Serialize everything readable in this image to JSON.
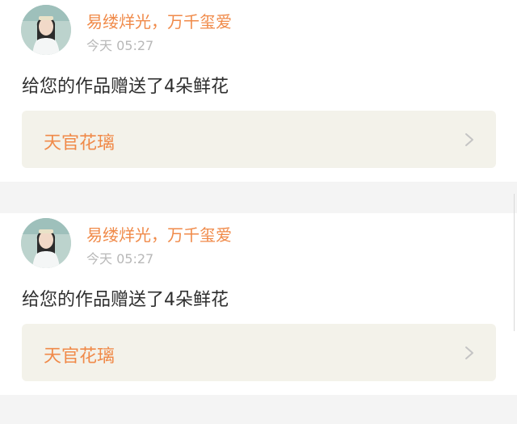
{
  "feed": {
    "items": [
      {
        "username": "易缕烊光，万千玺爱",
        "time": "今天 05:27",
        "message": "给您的作品赠送了4朵鲜花",
        "work_title": "天官花璃"
      },
      {
        "username": "易缕烊光，万千玺爱",
        "time": "今天 05:27",
        "message": "给您的作品赠送了4朵鲜花",
        "work_title": "天官花璃"
      }
    ]
  },
  "icons": {
    "avatar": "avatar-image",
    "chevron": "chevron-right-icon"
  },
  "colors": {
    "accent": "#f08a49",
    "timestamp": "#b8b8b8",
    "message": "#2e2e2e",
    "card_link_bg": "#f3f2ea",
    "page_bg": "#f4f4f4"
  }
}
